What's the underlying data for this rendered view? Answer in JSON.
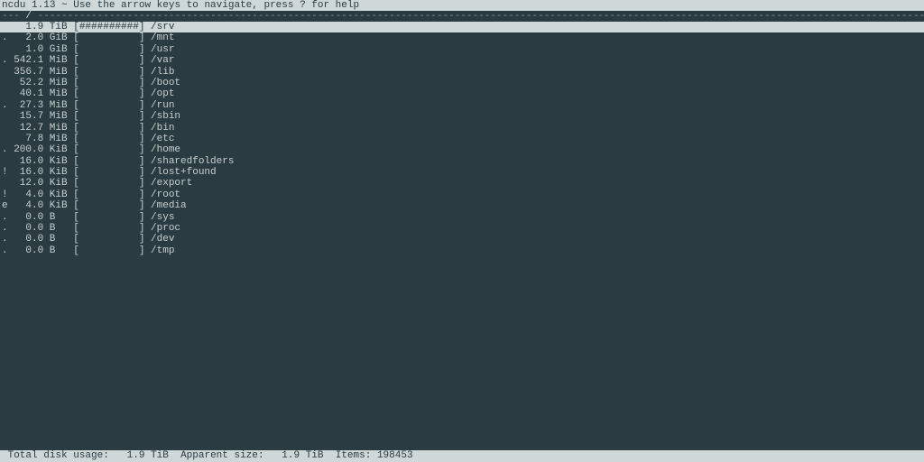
{
  "header": {
    "app": "ncdu",
    "version": "1.13",
    "hint": "Use the arrow keys to navigate, press ? for help"
  },
  "breadcrumb": {
    "prefix": "---",
    "path": "/",
    "dash_fill": "----------------------------------------------------------------------------------------------------------------------------------------------------------------------------------------------------------------------------------------------"
  },
  "rows": [
    {
      "flag": " ",
      "size": "1.9",
      "unit": "TiB",
      "bar": "##########",
      "name": "/srv",
      "selected": true
    },
    {
      "flag": ".",
      "size": "2.0",
      "unit": "GiB",
      "bar": "          ",
      "name": "/mnt",
      "selected": false
    },
    {
      "flag": " ",
      "size": "1.0",
      "unit": "GiB",
      "bar": "          ",
      "name": "/usr",
      "selected": false
    },
    {
      "flag": ".",
      "size": "542.1",
      "unit": "MiB",
      "bar": "          ",
      "name": "/var",
      "selected": false
    },
    {
      "flag": " ",
      "size": "356.7",
      "unit": "MiB",
      "bar": "          ",
      "name": "/lib",
      "selected": false
    },
    {
      "flag": " ",
      "size": "52.2",
      "unit": "MiB",
      "bar": "          ",
      "name": "/boot",
      "selected": false
    },
    {
      "flag": " ",
      "size": "40.1",
      "unit": "MiB",
      "bar": "          ",
      "name": "/opt",
      "selected": false
    },
    {
      "flag": ".",
      "size": "27.3",
      "unit": "MiB",
      "bar": "          ",
      "name": "/run",
      "selected": false
    },
    {
      "flag": " ",
      "size": "15.7",
      "unit": "MiB",
      "bar": "          ",
      "name": "/sbin",
      "selected": false
    },
    {
      "flag": " ",
      "size": "12.7",
      "unit": "MiB",
      "bar": "          ",
      "name": "/bin",
      "selected": false
    },
    {
      "flag": " ",
      "size": "7.8",
      "unit": "MiB",
      "bar": "          ",
      "name": "/etc",
      "selected": false
    },
    {
      "flag": ".",
      "size": "200.0",
      "unit": "KiB",
      "bar": "          ",
      "name": "/home",
      "selected": false
    },
    {
      "flag": " ",
      "size": "16.0",
      "unit": "KiB",
      "bar": "          ",
      "name": "/sharedfolders",
      "selected": false
    },
    {
      "flag": "!",
      "size": "16.0",
      "unit": "KiB",
      "bar": "          ",
      "name": "/lost+found",
      "selected": false
    },
    {
      "flag": " ",
      "size": "12.0",
      "unit": "KiB",
      "bar": "          ",
      "name": "/export",
      "selected": false
    },
    {
      "flag": "!",
      "size": "4.0",
      "unit": "KiB",
      "bar": "          ",
      "name": "/root",
      "selected": false
    },
    {
      "flag": "e",
      "size": "4.0",
      "unit": "KiB",
      "bar": "          ",
      "name": "/media",
      "selected": false
    },
    {
      "flag": ".",
      "size": "0.0",
      "unit": "B",
      "bar": "          ",
      "name": "/sys",
      "selected": false
    },
    {
      "flag": ".",
      "size": "0.0",
      "unit": "B",
      "bar": "          ",
      "name": "/proc",
      "selected": false
    },
    {
      "flag": ".",
      "size": "0.0",
      "unit": "B",
      "bar": "          ",
      "name": "/dev",
      "selected": false
    },
    {
      "flag": ".",
      "size": "0.0",
      "unit": "B",
      "bar": "          ",
      "name": "/tmp",
      "selected": false
    }
  ],
  "footer": {
    "total_label": "Total disk usage:",
    "total_value": "1.9 TiB",
    "apparent_label": "Apparent size:",
    "apparent_value": "1.9 TiB",
    "items_label": "Items:",
    "items_value": "198453"
  }
}
